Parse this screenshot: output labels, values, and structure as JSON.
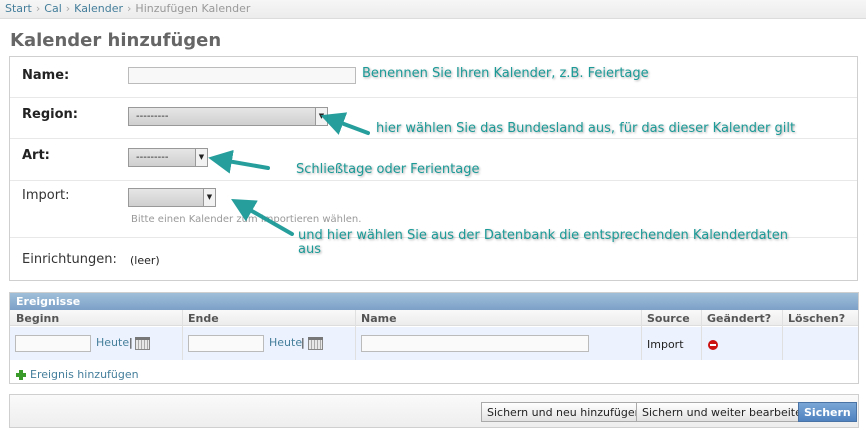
{
  "breadcrumbs": [
    "Start",
    "Cal",
    "Kalender",
    "Hinzufügen Kalender"
  ],
  "breadcrumb_separator": "›",
  "page_title": "Kalender hinzufügen",
  "form": {
    "name_label": "Name:",
    "name_value": "",
    "region_label": "Region:",
    "region_selected": "---------",
    "art_label": "Art:",
    "art_selected": "---------",
    "import_label": "Import:",
    "import_selected": "",
    "import_help": "Bitte einen Kalender zum importieren wählen.",
    "einrichtungen_label": "Einrichtungen:",
    "einrichtungen_value": "(leer)"
  },
  "annotations": {
    "name_note": "Benennen Sie Ihren Kalender, z.B. Feiertage",
    "region_note": "hier wählen Sie das Bundesland aus, für das dieser Kalender gilt",
    "art_note": "Schließtage oder Ferientage",
    "import_note_line1": "und hier wählen Sie aus der Datenbank die entsprechenden Kalenderdaten",
    "import_note_line2": "aus",
    "color": "#1b9a97"
  },
  "inline": {
    "title": "Ereignisse",
    "columns": [
      "Beginn",
      "Ende",
      "Name",
      "Source",
      "Geändert?",
      "Löschen?"
    ],
    "row": {
      "beginn_today": "Heute",
      "ende_today": "Heute",
      "separator": "|",
      "source": "Import"
    },
    "add_label": "Ereignis hinzufügen"
  },
  "buttons": {
    "save_add": "Sichern und neu hinzufügen",
    "save_continue": "Sichern und weiter bearbeiten",
    "save": "Sichern"
  },
  "icons": {
    "calendar": "calendar-icon",
    "delete": "delete-icon",
    "add": "add-icon",
    "chevron": "chevron-down-icon"
  }
}
